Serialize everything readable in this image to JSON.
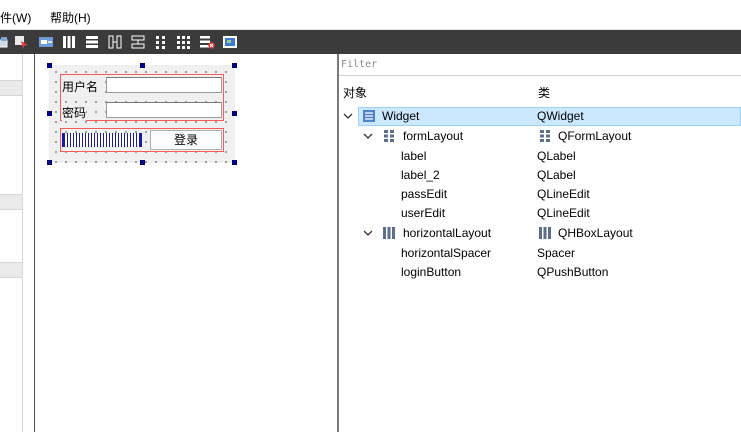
{
  "menu": {
    "items": [
      {
        "label": "文件(W)"
      },
      {
        "label": "帮助(H)"
      }
    ]
  },
  "toolbar": {
    "icons": [
      "add-widget-icon",
      "edit-signals-icon",
      "edit-buddies-icon",
      "layout-horizontal-icon",
      "layout-vertical-icon",
      "layout-horizontal-splitter-icon",
      "layout-vertical-splitter-icon",
      "layout-form-icon",
      "layout-grid-icon",
      "break-layout-icon",
      "adjust-size-icon"
    ]
  },
  "form": {
    "username_label": "用户名",
    "password_label": "密码",
    "login_button": "登录"
  },
  "inspector": {
    "filter_placeholder": "Filter",
    "col_object": "对象",
    "col_class": "类",
    "rows": [
      {
        "object": "Widget",
        "class": "QWidget",
        "icon": "widget-icon",
        "class_icon": "widget-icon"
      },
      {
        "object": "formLayout",
        "class": "QFormLayout",
        "icon": "form-layout-icon",
        "class_icon": "form-layout-icon"
      },
      {
        "object": "label",
        "class": "QLabel"
      },
      {
        "object": "label_2",
        "class": "QLabel"
      },
      {
        "object": "passEdit",
        "class": "QLineEdit"
      },
      {
        "object": "userEdit",
        "class": "QLineEdit"
      },
      {
        "object": "horizontalLayout",
        "class": "QHBoxLayout",
        "icon": "hbox-layout-icon",
        "class_icon": "hbox-layout-icon"
      },
      {
        "object": "horizontalSpacer",
        "class": "Spacer"
      },
      {
        "object": "loginButton",
        "class": "QPushButton"
      }
    ]
  },
  "colors": {
    "toolbar_bg": "#3b3b3b",
    "selection_bg": "#cce8ff",
    "layout_outline": "#ff5a5a",
    "handle": "#000080"
  }
}
